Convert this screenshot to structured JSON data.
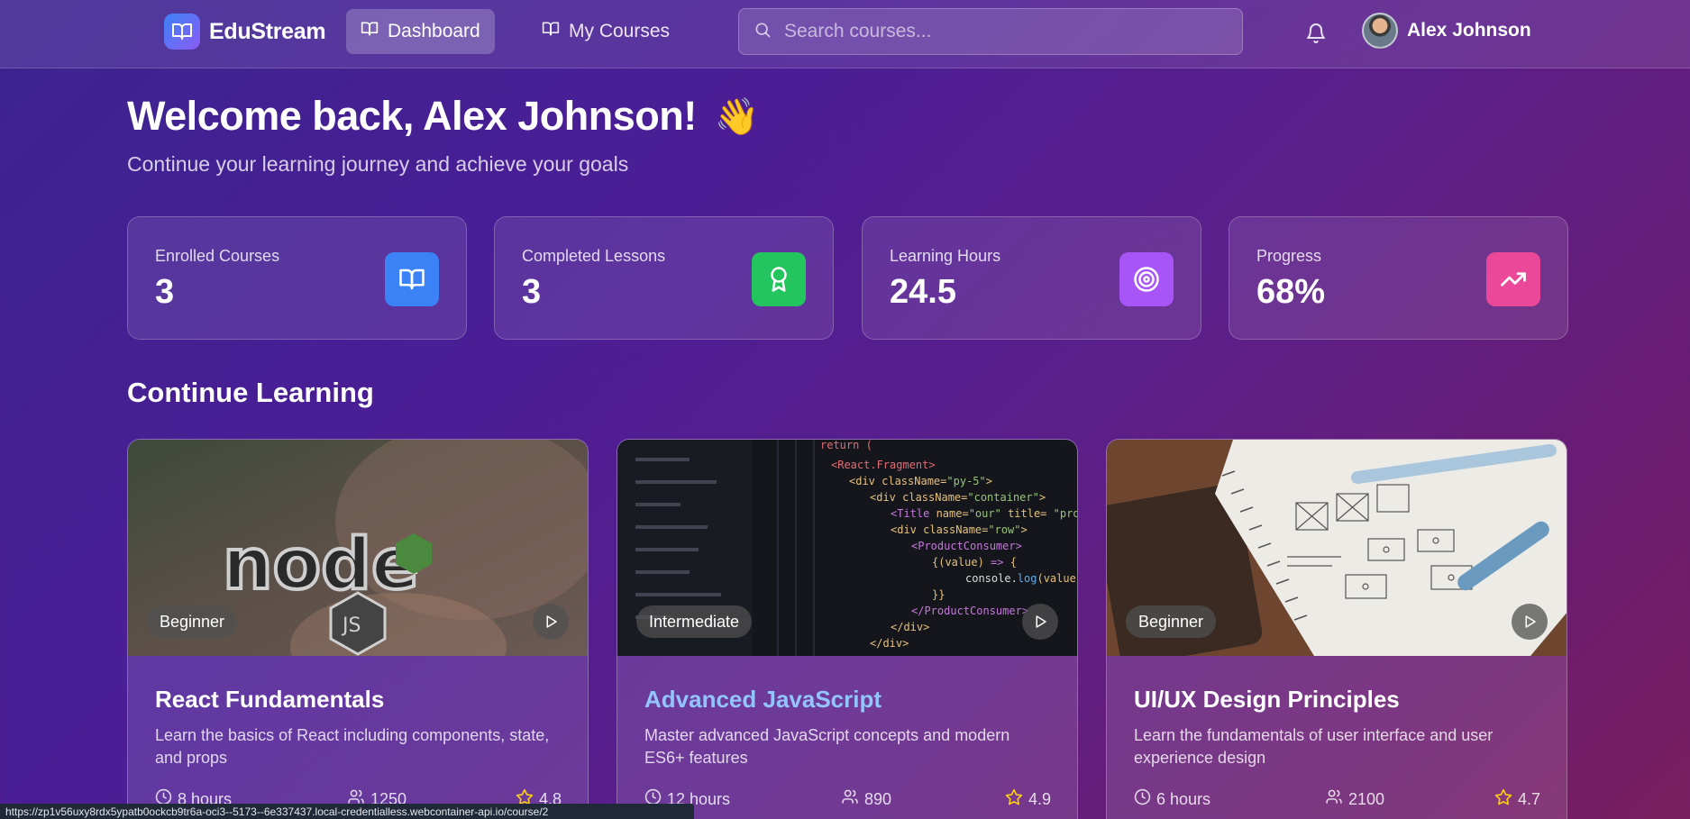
{
  "brand": {
    "name": "EduStream",
    "icon": "book-open-icon"
  },
  "nav": {
    "tabs": [
      {
        "label": "Dashboard",
        "icon": "book-open-icon",
        "active": true
      },
      {
        "label": "My Courses",
        "icon": "book-open-icon",
        "active": false
      }
    ]
  },
  "search": {
    "placeholder": "Search courses...",
    "value": ""
  },
  "user": {
    "name": "Alex Johnson"
  },
  "welcome": {
    "title": "Welcome back, Alex Johnson!",
    "emoji": "👋",
    "subtitle": "Continue your learning journey and achieve your goals"
  },
  "stats": [
    {
      "label": "Enrolled Courses",
      "value": "3",
      "icon": "book-open-icon",
      "color": "#3b82f6"
    },
    {
      "label": "Completed Lessons",
      "value": "3",
      "icon": "award-icon",
      "color": "#22c55e"
    },
    {
      "label": "Learning Hours",
      "value": "24.5",
      "icon": "target-icon",
      "color": "#a855f7"
    },
    {
      "label": "Progress",
      "value": "68%",
      "icon": "trending-up-icon",
      "color": "#ec4899"
    }
  ],
  "continue_learning": {
    "title": "Continue Learning",
    "courses": [
      {
        "level": "Beginner",
        "title": "React Fundamentals",
        "description": "Learn the basics of React including components, state, and props",
        "duration": "8 hours",
        "students": "1250",
        "rating": "4.8",
        "image": "node-logo-photo"
      },
      {
        "level": "Intermediate",
        "title": "Advanced JavaScript",
        "description": "Master advanced JavaScript concepts and modern ES6+ features",
        "duration": "12 hours",
        "students": "890",
        "rating": "4.9",
        "image": "code-editor-photo"
      },
      {
        "level": "Beginner",
        "title": "UI/UX Design Principles",
        "description": "Learn the fundamentals of user interface and user experience design",
        "duration": "6 hours",
        "students": "2100",
        "rating": "4.7",
        "image": "wireframe-notebook-photo"
      }
    ]
  },
  "status_bar": {
    "url": "https://zp1v56uxy8rdx5ypatb0ockcb9tr6a-oci3--5173--6e337437.local-credentialless.webcontainer-api.io/course/2"
  }
}
